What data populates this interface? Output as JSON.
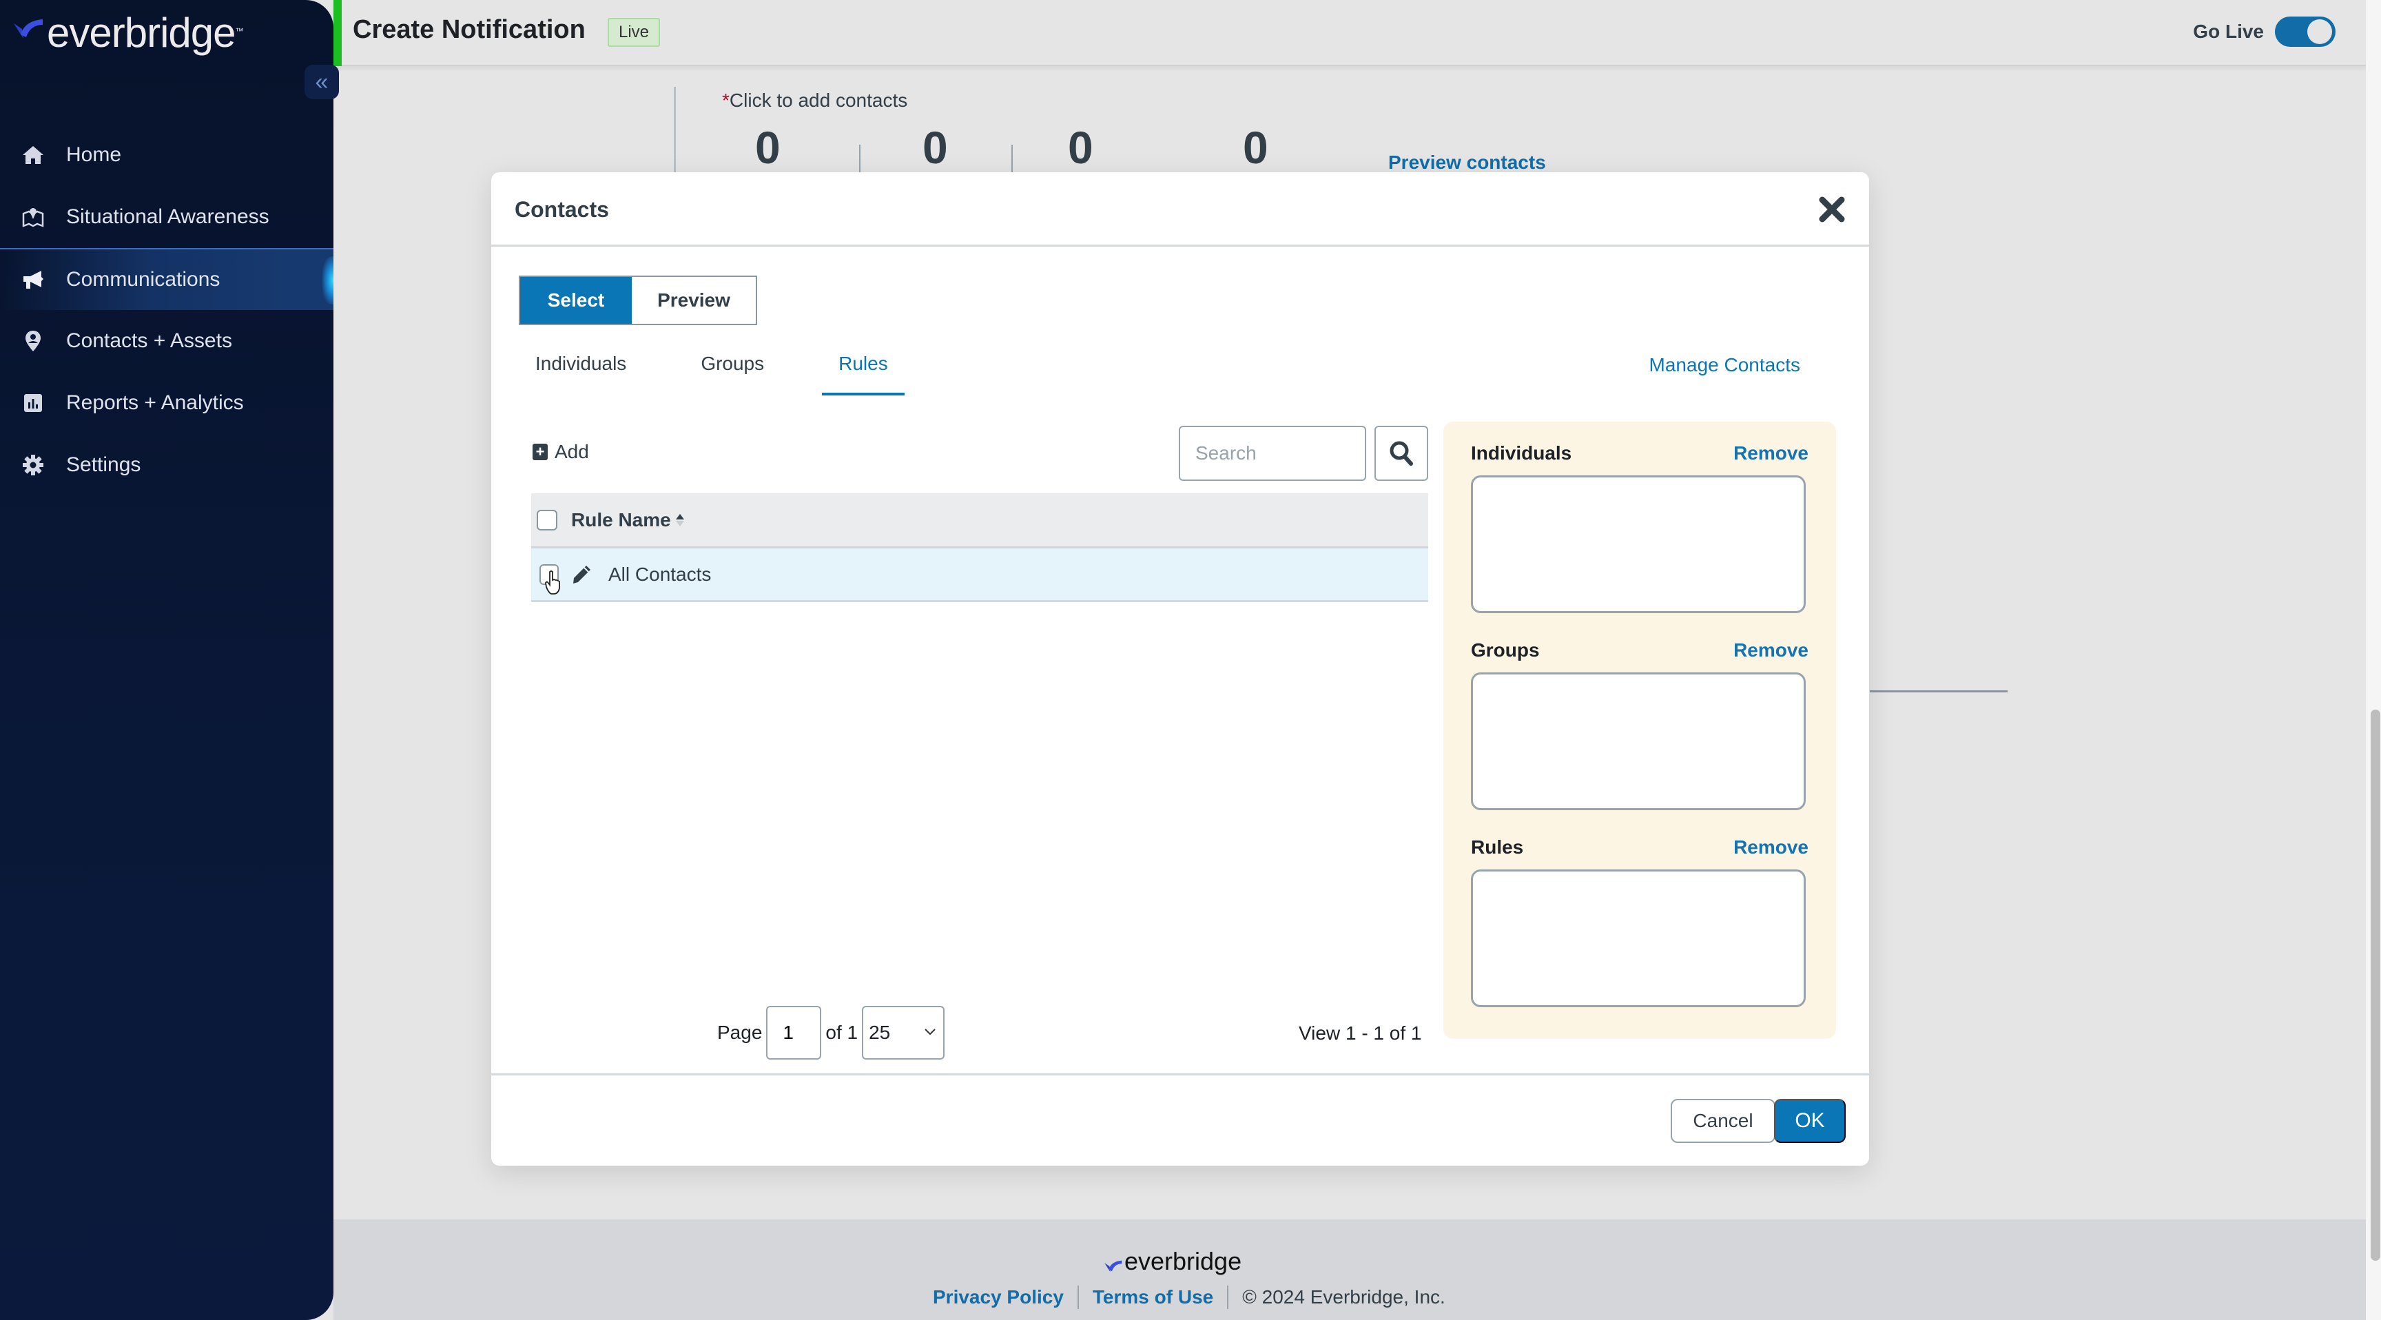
{
  "sidebar": {
    "logo_text": "everbridge",
    "logo_tm": "™",
    "collapse_label": "«",
    "items": [
      {
        "label": "Home",
        "icon": "home-icon",
        "active": false
      },
      {
        "label": "Situational Awareness",
        "icon": "map-pin-icon",
        "active": false
      },
      {
        "label": "Communications",
        "icon": "megaphone-icon",
        "active": true
      },
      {
        "label": "Contacts + Assets",
        "icon": "location-person-icon",
        "active": false
      },
      {
        "label": "Reports + Analytics",
        "icon": "bar-chart-icon",
        "active": false
      },
      {
        "label": "Settings",
        "icon": "gear-icon",
        "active": false
      }
    ]
  },
  "header": {
    "title": "Create Notification",
    "badge": "Live",
    "go_live_label": "Go Live",
    "go_live_on": true,
    "colors": {
      "accent_green": "#1bbf22",
      "toggle": "#116ca8"
    }
  },
  "background": {
    "contacts_required_mark": "*",
    "contacts_label": "Click to add contacts",
    "counts": [
      "0",
      "0",
      "0",
      "0"
    ],
    "preview_contacts": "Preview contacts"
  },
  "modal": {
    "title": "Contacts",
    "close_icon": "close-icon",
    "segments": [
      {
        "label": "Select",
        "active": true
      },
      {
        "label": "Preview",
        "active": false
      }
    ],
    "tabs": [
      {
        "label": "Individuals",
        "active": false
      },
      {
        "label": "Groups",
        "active": false
      },
      {
        "label": "Rules",
        "active": true
      }
    ],
    "manage_contacts": "Manage Contacts",
    "add_label": "Add",
    "search": {
      "placeholder": "Search",
      "value": ""
    },
    "grid": {
      "columns": [
        {
          "label": "Rule Name",
          "sort": "ascending"
        }
      ],
      "rows": [
        {
          "name": "All Contacts",
          "checked": false
        }
      ]
    },
    "pager": {
      "page_label": "Page",
      "page_value": "1",
      "of_label": "of 1",
      "page_size": "25",
      "view_text": "View 1 - 1 of 1"
    },
    "selected": {
      "sections": [
        {
          "label": "Individuals",
          "remove": "Remove"
        },
        {
          "label": "Groups",
          "remove": "Remove"
        },
        {
          "label": "Rules",
          "remove": "Remove"
        }
      ]
    },
    "footer": {
      "cancel": "Cancel",
      "ok": "OK"
    },
    "colors": {
      "primary": "#0b76b6",
      "panel_bg": "#fcf5e4",
      "row_highlight": "#e5f3fb"
    }
  },
  "footer": {
    "logo_text": "everbridge",
    "privacy": "Privacy Policy",
    "terms": "Terms of Use",
    "copyright": "© 2024 Everbridge, Inc."
  }
}
